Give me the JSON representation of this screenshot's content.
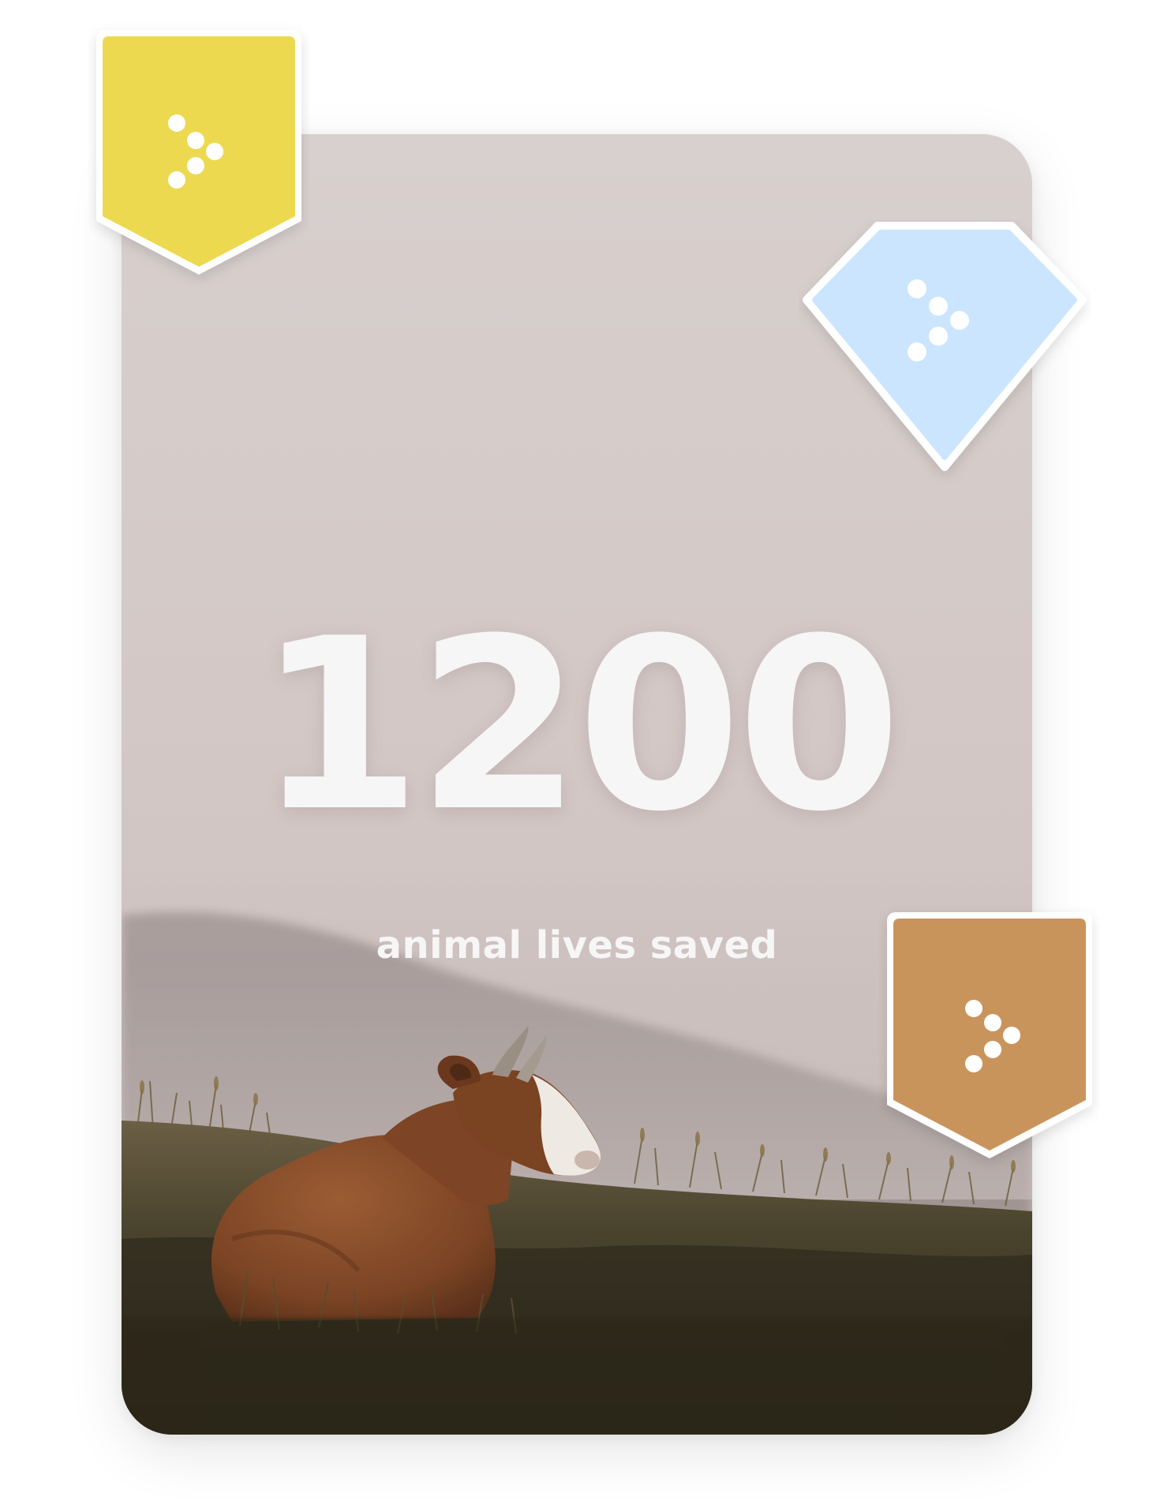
{
  "stat": {
    "value": "1200",
    "label": "animal lives saved"
  },
  "badges": [
    {
      "shape": "pentagon-shield",
      "color": "#ecd94f",
      "icon": "dots-arrow-icon"
    },
    {
      "shape": "diamond",
      "color": "#cbe5fe",
      "icon": "dots-arrow-icon"
    },
    {
      "shape": "pentagon-shield",
      "color": "#c9945c",
      "icon": "dots-arrow-icon"
    }
  ],
  "background": {
    "subject": "cow-lying-in-misty-meadow",
    "sky_color": "#d8cdcb",
    "hill_color": "#a79a98",
    "grass_color": "#3f3a27"
  }
}
